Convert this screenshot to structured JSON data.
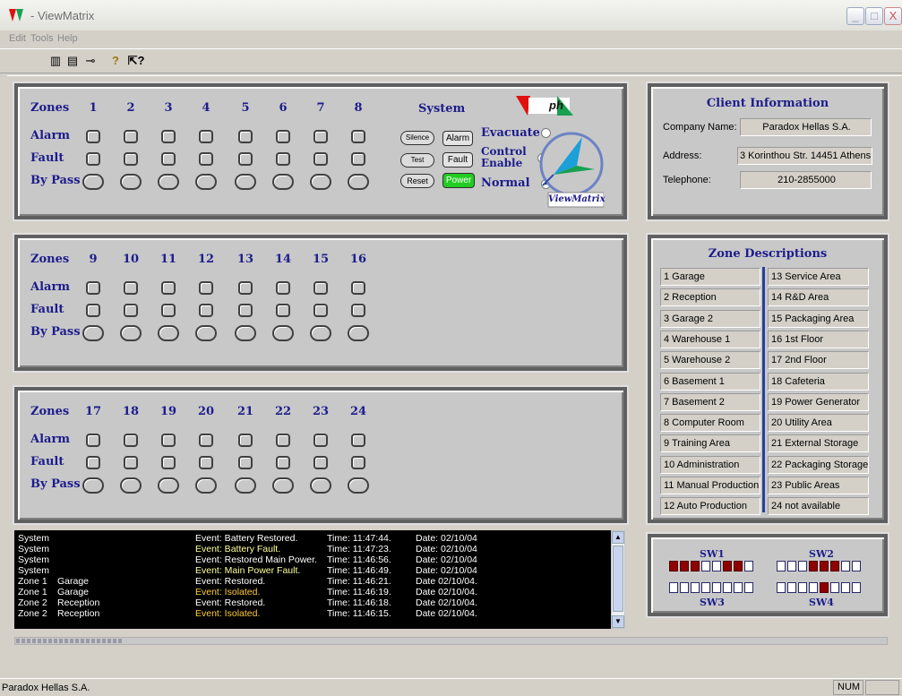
{
  "window": {
    "title": "- ViewMatrix",
    "minimize": "_",
    "maximize": "□",
    "close": "X"
  },
  "menu": [
    "Edit",
    "Tools",
    "Help"
  ],
  "toolbar": [
    {
      "icon": "columns-icon",
      "glyph": "▥"
    },
    {
      "icon": "list-icon",
      "glyph": "▤"
    },
    {
      "icon": "arrow-key-icon",
      "glyph": "⊸"
    },
    {
      "icon": "help-icon",
      "glyph": "?"
    },
    {
      "icon": "context-help-icon",
      "glyph": "⇱?"
    }
  ],
  "zone_labels": {
    "zones": "Zones",
    "alarm": "Alarm",
    "fault": "Fault",
    "bypass": "By Pass"
  },
  "zone_groups": [
    [
      "1",
      "2",
      "3",
      "4",
      "5",
      "6",
      "7",
      "8"
    ],
    [
      "9",
      "10",
      "11",
      "12",
      "13",
      "14",
      "15",
      "16"
    ],
    [
      "17",
      "18",
      "19",
      "20",
      "21",
      "22",
      "23",
      "24"
    ]
  ],
  "system": {
    "title": "System",
    "silence": "Silence",
    "test": "Test",
    "reset": "Reset",
    "alarm": "Alarm",
    "fault": "Fault",
    "power": "Power",
    "evacuate": "Evacuate",
    "control": "Control",
    "enable": "Enable",
    "normal": "Normal",
    "logo_text": "ph",
    "brand": "ViewMatrix",
    "selected_mode": "Normal",
    "colors": {
      "power": "#22cc22",
      "logo_red": "#e01010",
      "logo_green": "#18a050"
    }
  },
  "client": {
    "title": "Client Information",
    "company_label": "Company Name:",
    "company": "Paradox Hellas S.A.",
    "address_label": "Address:",
    "address": "3 Korinthou Str. 14451 Athens",
    "phone_label": "Telephone:",
    "phone": "210-2855000"
  },
  "zone_desc": {
    "title": "Zone Descriptions",
    "left": [
      "1  Garage",
      "2  Reception",
      "3  Garage 2",
      "4  Warehouse 1",
      "5  Warehouse 2",
      "6  Basement 1",
      "7  Basement 2",
      "8  Computer Room",
      "9  Training Area",
      "10 Administration",
      "11 Manual Production",
      "12 Auto Production"
    ],
    "right": [
      "13 Service Area",
      "14 R&D Area",
      "15 Packaging Area",
      "16 1st Floor",
      "17 2nd Floor",
      "18 Cafeteria",
      "19 Power Generator",
      "20 Utility Area",
      "21 External Storage",
      "22 Packaging Storage",
      "23 Public Areas",
      "24 not available"
    ]
  },
  "log": [
    {
      "source": "System",
      "zone": "",
      "event": "Event: Battery Restored.",
      "time": "Time: 11:47:44.",
      "date": "Date: 02/10/04",
      "color": "#ffffff"
    },
    {
      "source": "System",
      "zone": "",
      "event": "Event: Battery Fault.",
      "time": "Time: 11:47:23.",
      "date": "Date: 02/10/04",
      "color": "#ffff99"
    },
    {
      "source": "System",
      "zone": "",
      "event": "Event: Restored Main Power.",
      "time": "Time: 11:46:56.",
      "date": "Date: 02/10/04",
      "color": "#ffffff"
    },
    {
      "source": "System",
      "zone": "",
      "event": "Event: Main Power Fault.",
      "time": "Time: 11:46:49.",
      "date": "Date: 02/10/04",
      "color": "#ffff99"
    },
    {
      "source": "Zone 1",
      "zone": "Garage",
      "event": "Event: Restored.",
      "time": "Time: 11:46:21.",
      "date": "Date 02/10/04.",
      "color": "#ffffff"
    },
    {
      "source": "Zone 1",
      "zone": "Garage",
      "event": "Event: Isolated.",
      "time": "Time: 11:46:19.",
      "date": "Date 02/10/04.",
      "color": "#ffcc33"
    },
    {
      "source": "Zone 2",
      "zone": "Reception",
      "event": "Event: Restored.",
      "time": "Time: 11:46:18.",
      "date": "Date 02/10/04.",
      "color": "#ffffff"
    },
    {
      "source": "Zone 2",
      "zone": "Reception",
      "event": "Event: Isolated.",
      "time": "Time: 11:46:15.",
      "date": "Date 02/10/04.",
      "color": "#ffcc33"
    }
  ],
  "switches": {
    "sw1": "SW1",
    "sw2": "SW2",
    "sw3": "SW3",
    "sw4": "SW4",
    "sw1_on": [
      1,
      2,
      3,
      6,
      7
    ],
    "sw2_on": [
      4,
      5,
      6
    ],
    "sw3_on": [],
    "sw4_on": [
      5
    ]
  },
  "status": {
    "company": "Paradox Hellas S.A.",
    "num": "NUM"
  }
}
